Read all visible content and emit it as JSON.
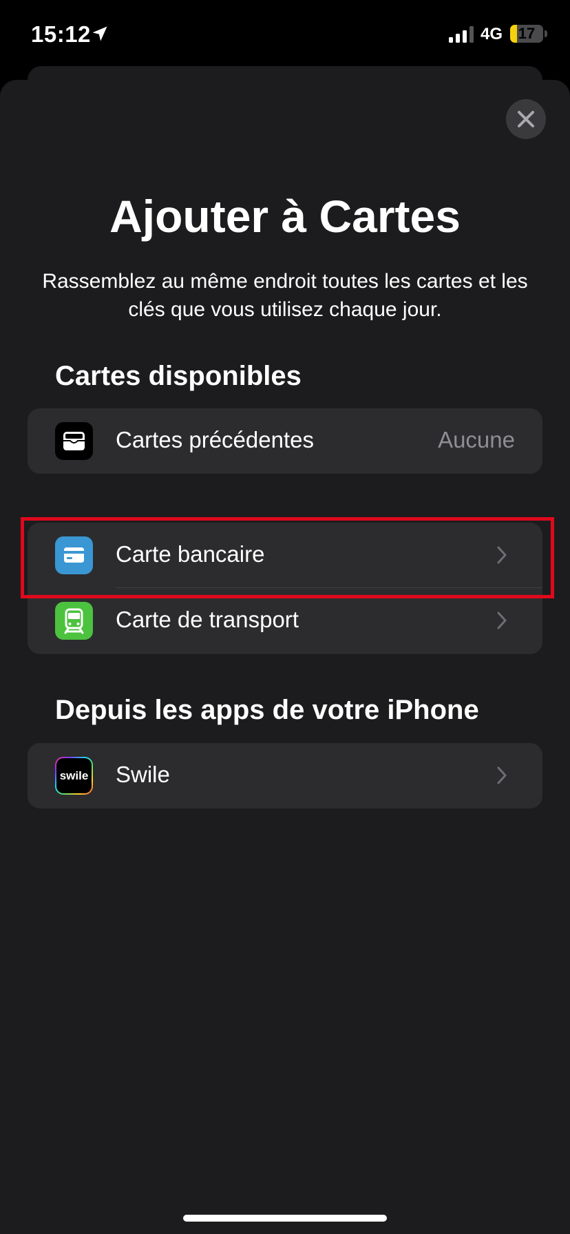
{
  "status_bar": {
    "time": "15:12",
    "network": "4G",
    "battery_level": "17",
    "battery_color": "#f5d10c"
  },
  "sheet": {
    "title": "Ajouter à Cartes",
    "subtitle": "Rassemblez au même endroit toutes les cartes et les clés que vous utilisez chaque jour."
  },
  "available_cards": {
    "header": "Cartes disponibles",
    "previous_cards": {
      "label": "Cartes précédentes",
      "value": "Aucune",
      "icon": "wallet-icon"
    },
    "items": [
      {
        "label": "Carte bancaire",
        "icon": "credit-card-icon",
        "icon_color": "#3a97d4"
      },
      {
        "label": "Carte de transport",
        "icon": "train-icon",
        "icon_color": "#4cc23f"
      }
    ]
  },
  "from_apps": {
    "header": "Depuis les apps de votre iPhone",
    "items": [
      {
        "label": "Swile",
        "icon_text": "swile"
      }
    ]
  },
  "highlight_color": "#e0091b"
}
